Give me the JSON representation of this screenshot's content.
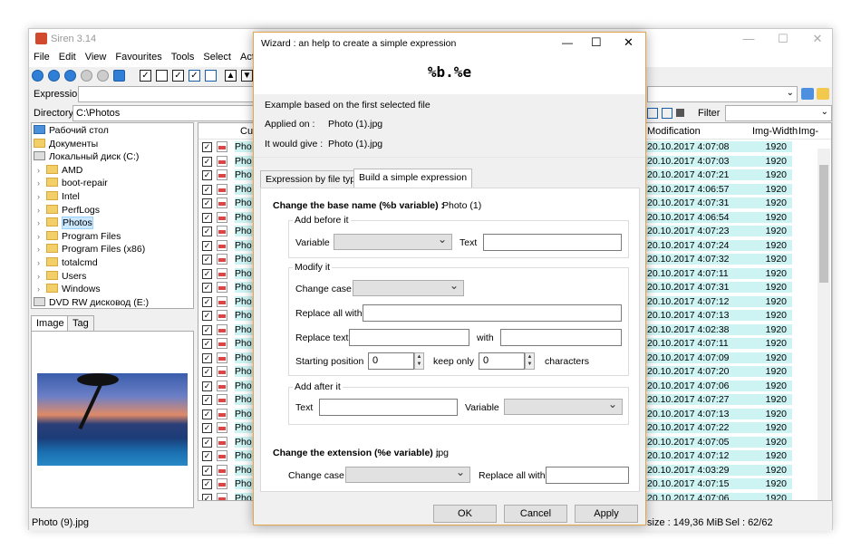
{
  "app": {
    "title": "Siren 3.14"
  },
  "menu": [
    "File",
    "Edit",
    "View",
    "Favourites",
    "Tools",
    "Select",
    "Action"
  ],
  "expression_label": "Expression",
  "directory": {
    "label": "Directory",
    "value": "C:\\Photos"
  },
  "filter_label": "Filter",
  "tree": [
    {
      "label": "Рабочий стол",
      "level": 0,
      "icon": "desktop-icon"
    },
    {
      "label": "Документы",
      "level": 0,
      "icon": "folder-icon"
    },
    {
      "label": "Локальный диск (C:)",
      "level": 0,
      "icon": "drive-icon"
    },
    {
      "label": "AMD",
      "level": 1
    },
    {
      "label": "boot-repair",
      "level": 1
    },
    {
      "label": "Intel",
      "level": 1
    },
    {
      "label": "PerfLogs",
      "level": 1
    },
    {
      "label": "Photos",
      "level": 1,
      "selected": true
    },
    {
      "label": "Program Files",
      "level": 1
    },
    {
      "label": "Program Files (x86)",
      "level": 1
    },
    {
      "label": "totalcmd",
      "level": 1
    },
    {
      "label": "Users",
      "level": 1
    },
    {
      "label": "Windows",
      "level": 1
    },
    {
      "label": "DVD RW дисковод (E:)",
      "level": 0,
      "icon": "dvd-icon"
    }
  ],
  "left_tabs": [
    "Image",
    "Tag"
  ],
  "list": {
    "headers": [
      "Cur",
      "Modification",
      "Img-Width",
      "Img-"
    ],
    "name_prefix": "Pho",
    "rows": [
      [
        "20.10.2017 4:07:08",
        "1920"
      ],
      [
        "20.10.2017 4:07:03",
        "1920"
      ],
      [
        "20.10.2017 4:07:21",
        "1920"
      ],
      [
        "20.10.2017 4:06:57",
        "1920"
      ],
      [
        "20.10.2017 4:07:31",
        "1920"
      ],
      [
        "20.10.2017 4:06:54",
        "1920"
      ],
      [
        "20.10.2017 4:07:23",
        "1920"
      ],
      [
        "20.10.2017 4:07:24",
        "1920"
      ],
      [
        "20.10.2017 4:07:32",
        "1920"
      ],
      [
        "20.10.2017 4:07:11",
        "1920"
      ],
      [
        "20.10.2017 4:07:31",
        "1920"
      ],
      [
        "20.10.2017 4:07:12",
        "1920"
      ],
      [
        "20.10.2017 4:07:13",
        "1920"
      ],
      [
        "20.10.2017 4:02:38",
        "1920"
      ],
      [
        "20.10.2017 4:07:11",
        "1920"
      ],
      [
        "20.10.2017 4:07:09",
        "1920"
      ],
      [
        "20.10.2017 4:07:20",
        "1920"
      ],
      [
        "20.10.2017 4:07:06",
        "1920"
      ],
      [
        "20.10.2017 4:07:27",
        "1920"
      ],
      [
        "20.10.2017 4:07:13",
        "1920"
      ],
      [
        "20.10.2017 4:07:22",
        "1920"
      ],
      [
        "20.10.2017 4:07:05",
        "1920"
      ],
      [
        "20.10.2017 4:07:12",
        "1920"
      ],
      [
        "20.10.2017 4:03:29",
        "1920"
      ],
      [
        "20.10.2017 4:07:15",
        "1920"
      ],
      [
        "20.10.2017 4:07:06",
        "1920"
      ]
    ]
  },
  "status": {
    "file": "Photo (9).jpg",
    "size": "size : 149,36 MiB",
    "sel": "Sel : 62/62"
  },
  "dialog": {
    "title": "Wizard : an help to create a simple expression",
    "expression": "%b.%e",
    "example_header": "Example based on the first selected file",
    "applied_on_label": "Applied on :",
    "applied_on": "Photo (1).jpg",
    "would_give_label": "It would give :",
    "would_give": "Photo (1).jpg",
    "tabs": [
      "Expression by file type",
      "Build a simple expression"
    ],
    "base_name_label": "Change the base name (%b variable)  :",
    "base_name_value": "Photo (1)",
    "add_before": "Add before it",
    "variable": "Variable",
    "text": "Text",
    "modify": "Modify it",
    "change_case": "Change case",
    "replace_all_with": "Replace all with",
    "replace_text": "Replace text",
    "with": "with",
    "starting_position": "Starting position",
    "start_value": "0",
    "keep_only": "keep only",
    "keep_value": "0",
    "characters": "characters",
    "add_after": "Add after it",
    "ext_label": "Change the extension (%e variable)  :",
    "ext_value": "jpg",
    "buttons": {
      "ok": "OK",
      "cancel": "Cancel",
      "apply": "Apply"
    }
  }
}
